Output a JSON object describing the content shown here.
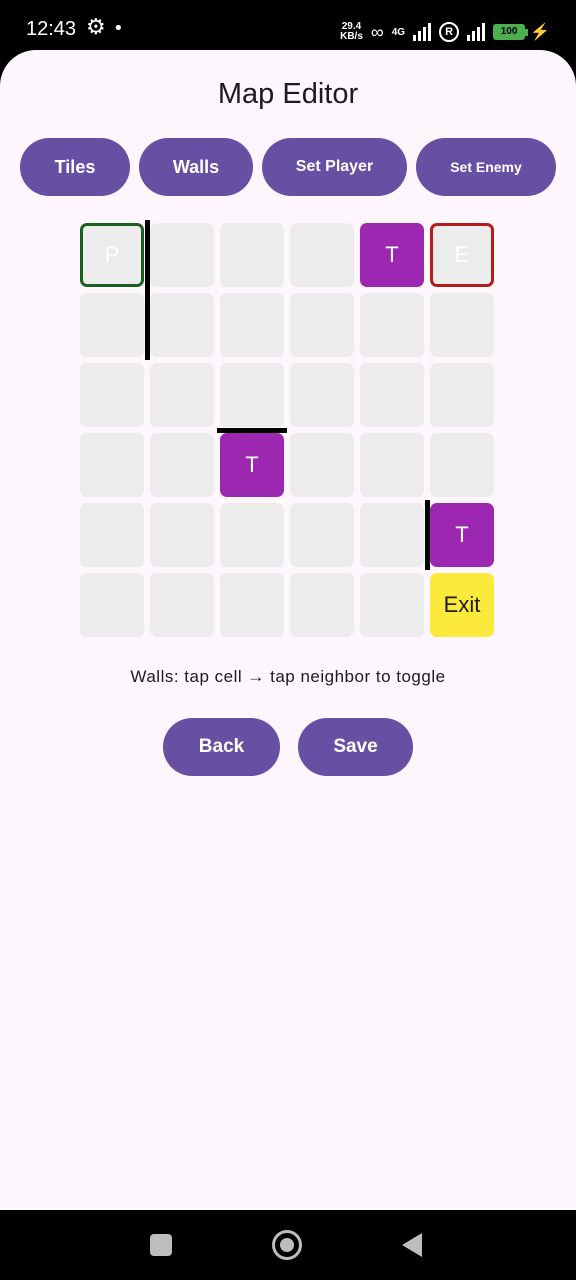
{
  "status_bar": {
    "time": "12:43",
    "net_speed_value": "29.4",
    "net_speed_unit": "KB/s",
    "network_type": "4G",
    "battery_level": "100"
  },
  "app": {
    "title": "Map Editor",
    "modes": [
      {
        "label": "Tiles"
      },
      {
        "label": "Walls"
      },
      {
        "label": "Set Player"
      },
      {
        "label": "Set Enemy"
      }
    ],
    "grid": {
      "rows": 6,
      "cols": 6,
      "cells": [
        {
          "row": 0,
          "col": 0,
          "type": "player",
          "label": "P"
        },
        {
          "row": 0,
          "col": 4,
          "type": "trap",
          "label": "T"
        },
        {
          "row": 0,
          "col": 5,
          "type": "enemy",
          "label": "E"
        },
        {
          "row": 3,
          "col": 2,
          "type": "trap",
          "label": "T"
        },
        {
          "row": 4,
          "col": 5,
          "type": "trap",
          "label": "T"
        },
        {
          "row": 5,
          "col": 5,
          "type": "exit",
          "label": "Exit"
        }
      ],
      "walls": [
        {
          "between": [
            [
              0,
              0
            ],
            [
              0,
              1
            ]
          ]
        },
        {
          "between": [
            [
              1,
              0
            ],
            [
              1,
              1
            ]
          ]
        },
        {
          "between": [
            [
              2,
              2
            ],
            [
              3,
              2
            ]
          ]
        },
        {
          "between": [
            [
              4,
              4
            ],
            [
              4,
              5
            ]
          ]
        }
      ]
    },
    "hint": "Walls: tap cell → tap neighbor to toggle",
    "back_label": "Back",
    "save_label": "Save"
  },
  "colors": {
    "primary": "#6750a4",
    "trap": "#9c27b0",
    "exit": "#fbe93b",
    "player_border": "#1b5e20",
    "enemy_border": "#b71c1c",
    "cell": "#ececec",
    "background": "#fdf6fd"
  }
}
